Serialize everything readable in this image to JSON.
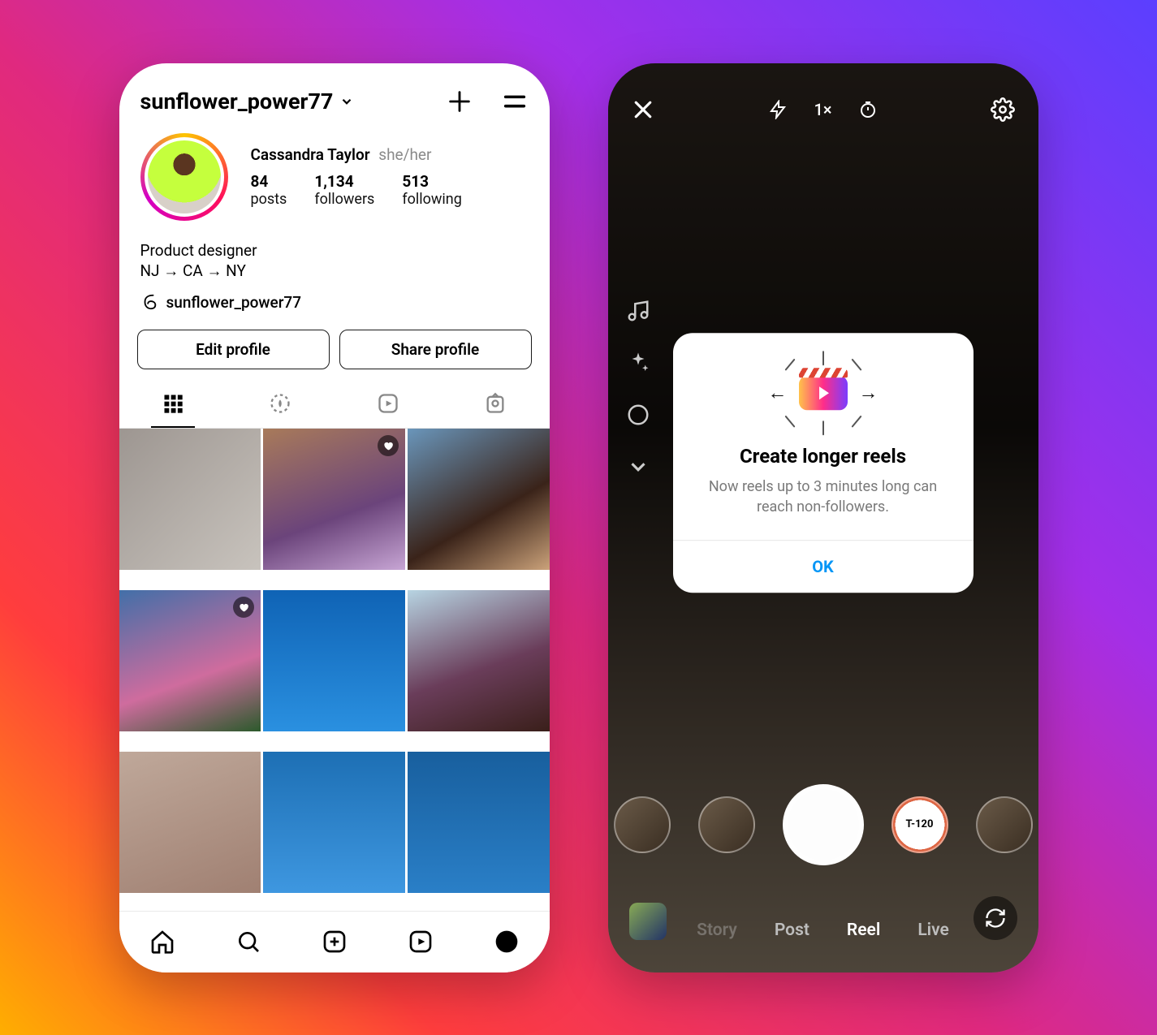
{
  "profile": {
    "username": "sunflower_power77",
    "display_name": "Cassandra Taylor",
    "pronouns": "she/her",
    "stats": {
      "posts": {
        "count": "84",
        "label": "posts"
      },
      "followers": {
        "count": "1,134",
        "label": "followers"
      },
      "following": {
        "count": "513",
        "label": "following"
      }
    },
    "bio_line1": "Product designer",
    "bio_line2": "NJ → CA → NY",
    "threads_handle": "sunflower_power77",
    "buttons": {
      "edit": "Edit profile",
      "share": "Share profile"
    }
  },
  "camera": {
    "top": {
      "speed": "1×"
    },
    "modes": {
      "story": "Story",
      "post": "Post",
      "reel": "Reel",
      "live": "Live"
    },
    "effect_label": "T-120"
  },
  "dialog": {
    "title": "Create longer reels",
    "body": "Now reels up to 3 minutes long can reach non-followers.",
    "ok": "OK"
  }
}
